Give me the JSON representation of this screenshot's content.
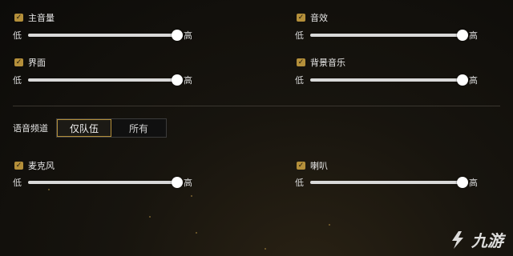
{
  "colors": {
    "accent": "#b48f3a",
    "track": "#d9d9d9",
    "knob": "#ffffff",
    "background": "#0c0b09"
  },
  "slider_labels": {
    "low": "低",
    "high": "高"
  },
  "audio": {
    "master": {
      "label": "主音量",
      "checked": true,
      "level": 1.0
    },
    "sfx": {
      "label": "音效",
      "checked": true,
      "level": 1.0
    },
    "ui": {
      "label": "界面",
      "checked": true,
      "level": 1.0
    },
    "bgm": {
      "label": "背景音乐",
      "checked": true,
      "level": 1.0
    },
    "mic": {
      "label": "麦克风",
      "checked": true,
      "level": 1.0
    },
    "speaker": {
      "label": "喇叭",
      "checked": true,
      "level": 1.0
    }
  },
  "voice_channel": {
    "label": "语音频道",
    "options": [
      "仅队伍",
      "所有"
    ],
    "selected": "仅队伍"
  },
  "watermark": {
    "text": "九游"
  }
}
